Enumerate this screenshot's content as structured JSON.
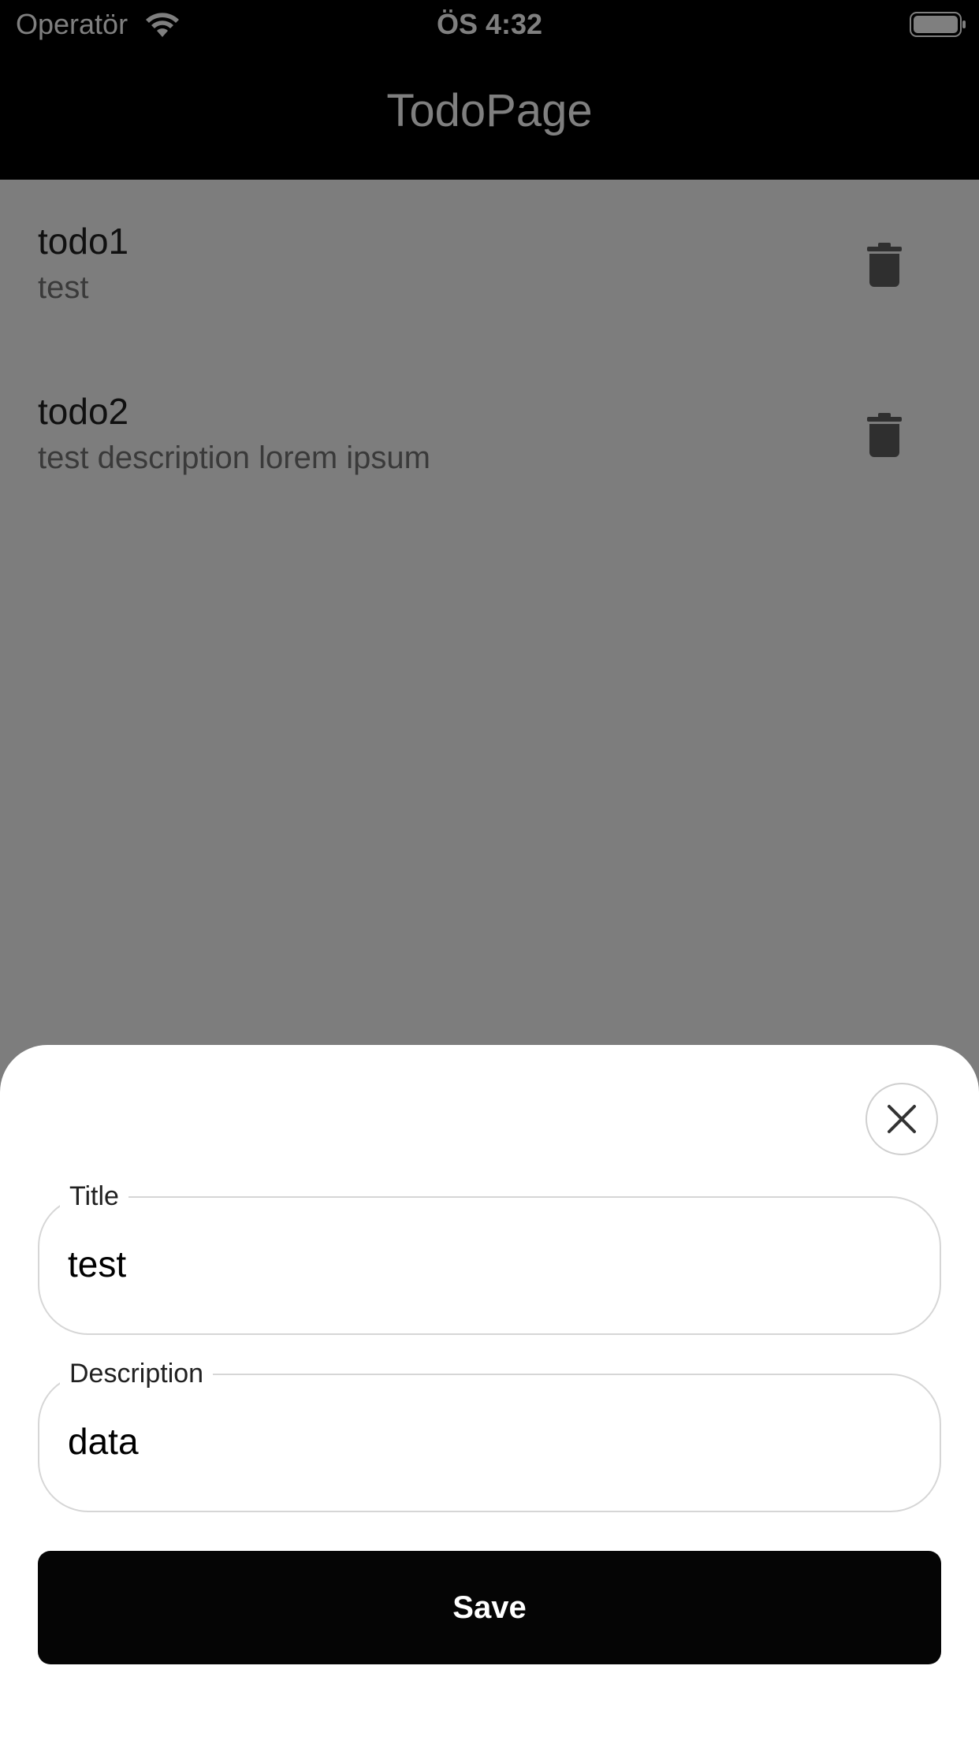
{
  "status_bar": {
    "carrier": "Operatör",
    "time": "ÖS 4:32"
  },
  "app_bar": {
    "title": "TodoPage"
  },
  "todos": [
    {
      "title": "todo1",
      "description": "test"
    },
    {
      "title": "todo2",
      "description": "test description lorem ipsum"
    }
  ],
  "sheet": {
    "title_field": {
      "label": "Title",
      "value": "test"
    },
    "description_field": {
      "label": "Description",
      "value": "data"
    },
    "save_label": "Save"
  },
  "icons": {
    "wifi": "wifi-icon",
    "battery": "battery-icon",
    "delete": "trash-icon",
    "close": "close-icon"
  },
  "colors": {
    "app_bar": "#000000",
    "save_button": "#050505",
    "scrim": "rgba(0,0,0,0.5)"
  }
}
